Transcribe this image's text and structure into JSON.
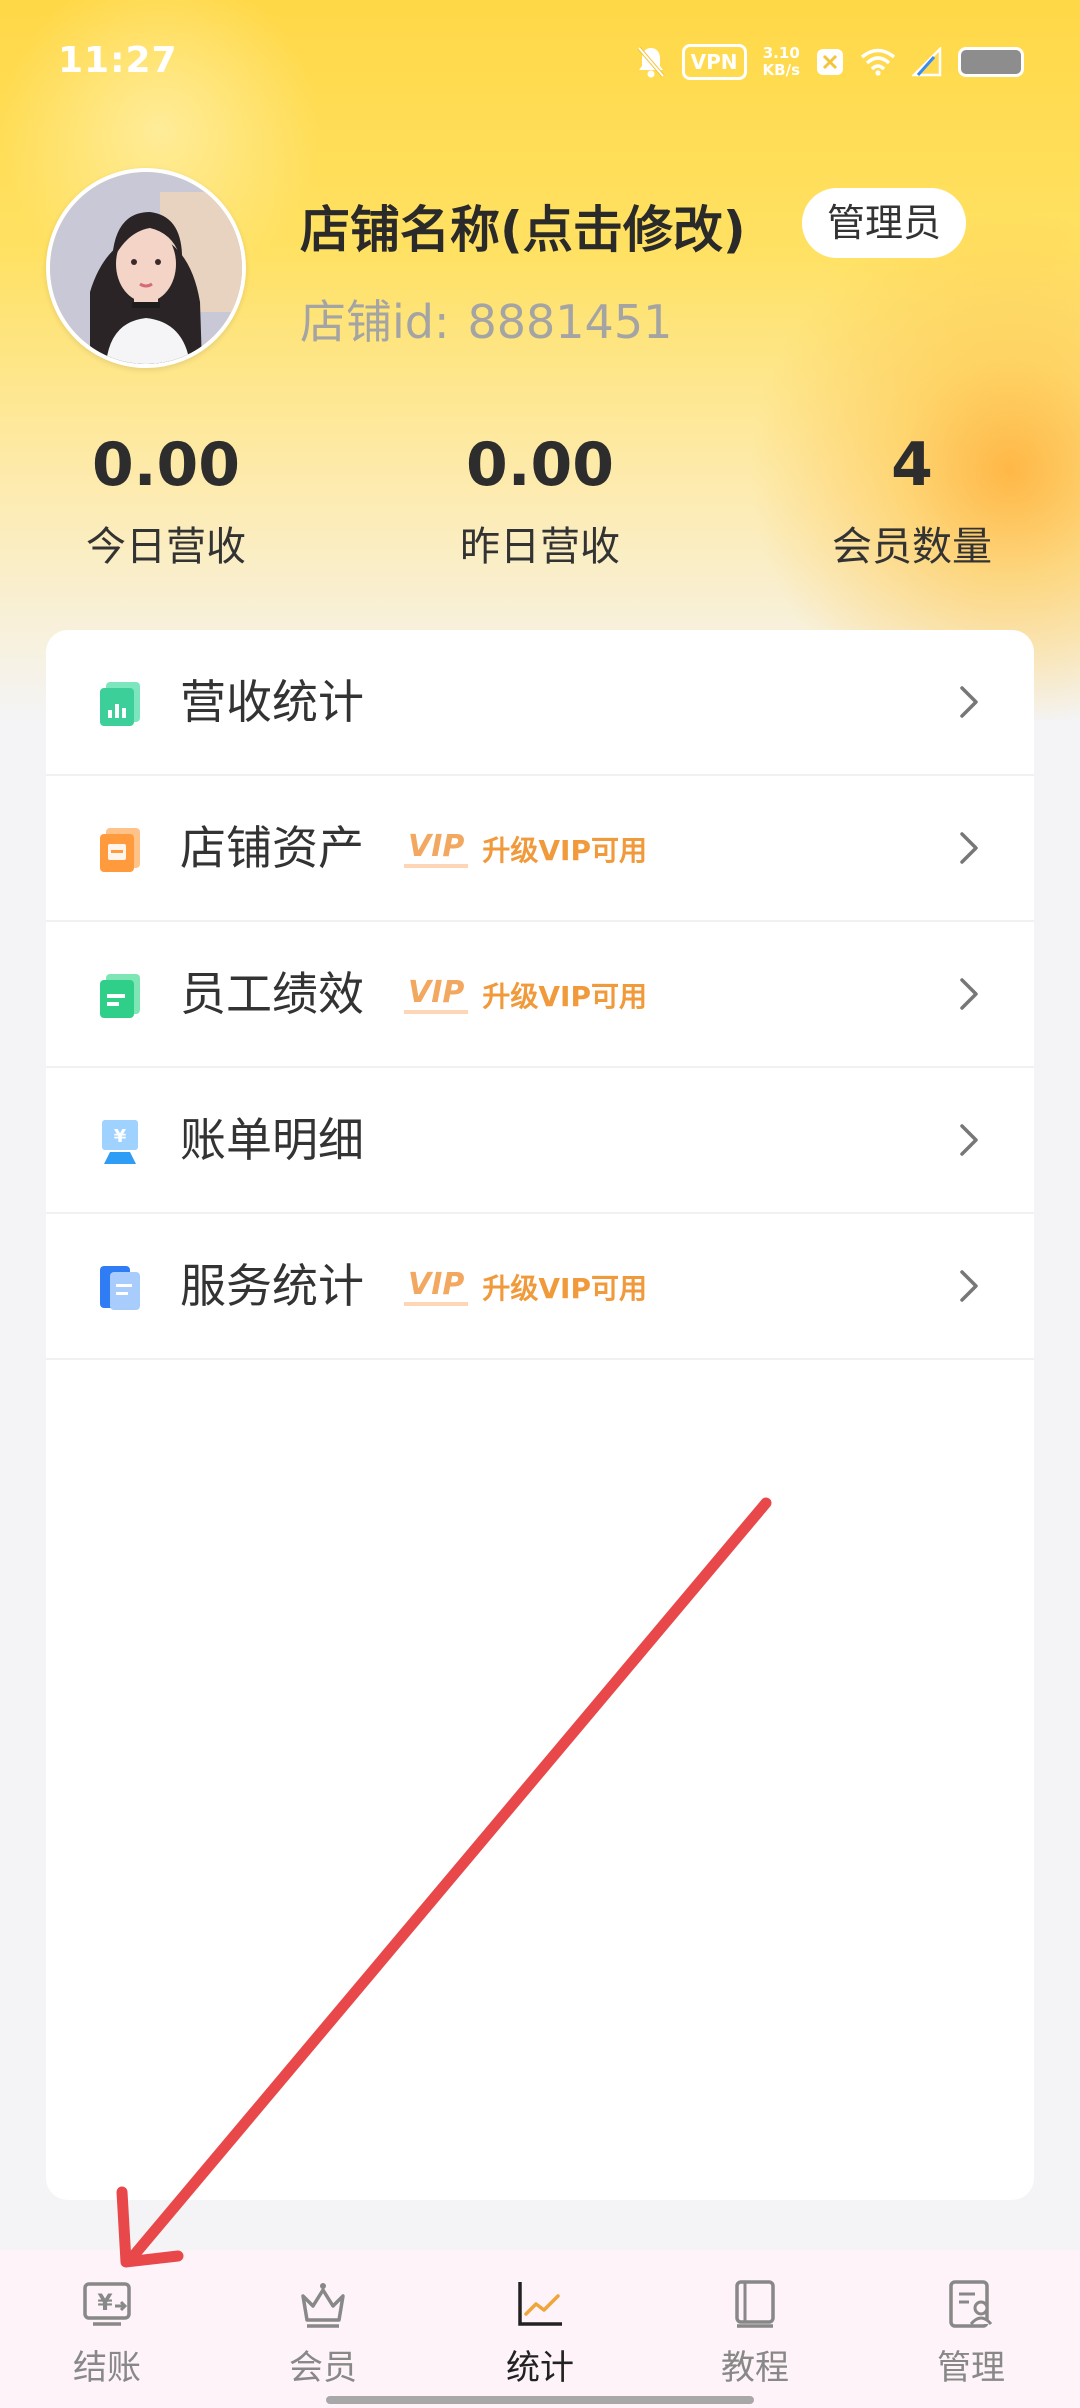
{
  "status_bar": {
    "time": "11:27",
    "vpn_label": "VPN",
    "net_speed_value": "3.10",
    "net_speed_unit": "KB/s"
  },
  "profile": {
    "shop_name": "店铺名称(点击修改)",
    "role_badge": "管理员",
    "shop_id_label": "店铺id:",
    "shop_id_value": "8881451"
  },
  "stats": [
    {
      "value": "0.00",
      "label": "今日营收"
    },
    {
      "value": "0.00",
      "label": "昨日营收"
    },
    {
      "value": "4",
      "label": "会员数量"
    }
  ],
  "menu": {
    "vip_tag": "VIP",
    "vip_text": "升级VIP可用",
    "items": [
      {
        "label": "营收统计",
        "icon": "revenue-chart-icon",
        "color": "#3ccf9a"
      },
      {
        "label": "店铺资产",
        "icon": "shop-assets-icon",
        "color": "#ff9a3d"
      },
      {
        "label": "员工绩效",
        "icon": "staff-performance-icon",
        "color": "#2fcf8a"
      },
      {
        "label": "账单明细",
        "icon": "bill-details-icon",
        "color": "#2f9cf5"
      },
      {
        "label": "服务统计",
        "icon": "service-stats-icon",
        "color": "#2f7cf5"
      }
    ]
  },
  "tabs": [
    {
      "label": "结账",
      "icon": "checkout-icon"
    },
    {
      "label": "会员",
      "icon": "crown-icon"
    },
    {
      "label": "统计",
      "icon": "chart-line-icon"
    },
    {
      "label": "教程",
      "icon": "book-icon"
    },
    {
      "label": "管理",
      "icon": "manage-doc-icon"
    }
  ],
  "colors": {
    "header_yellow": "#ffd847",
    "vip_orange": "#f09a3b",
    "annotation_arrow": "#e9484a"
  }
}
